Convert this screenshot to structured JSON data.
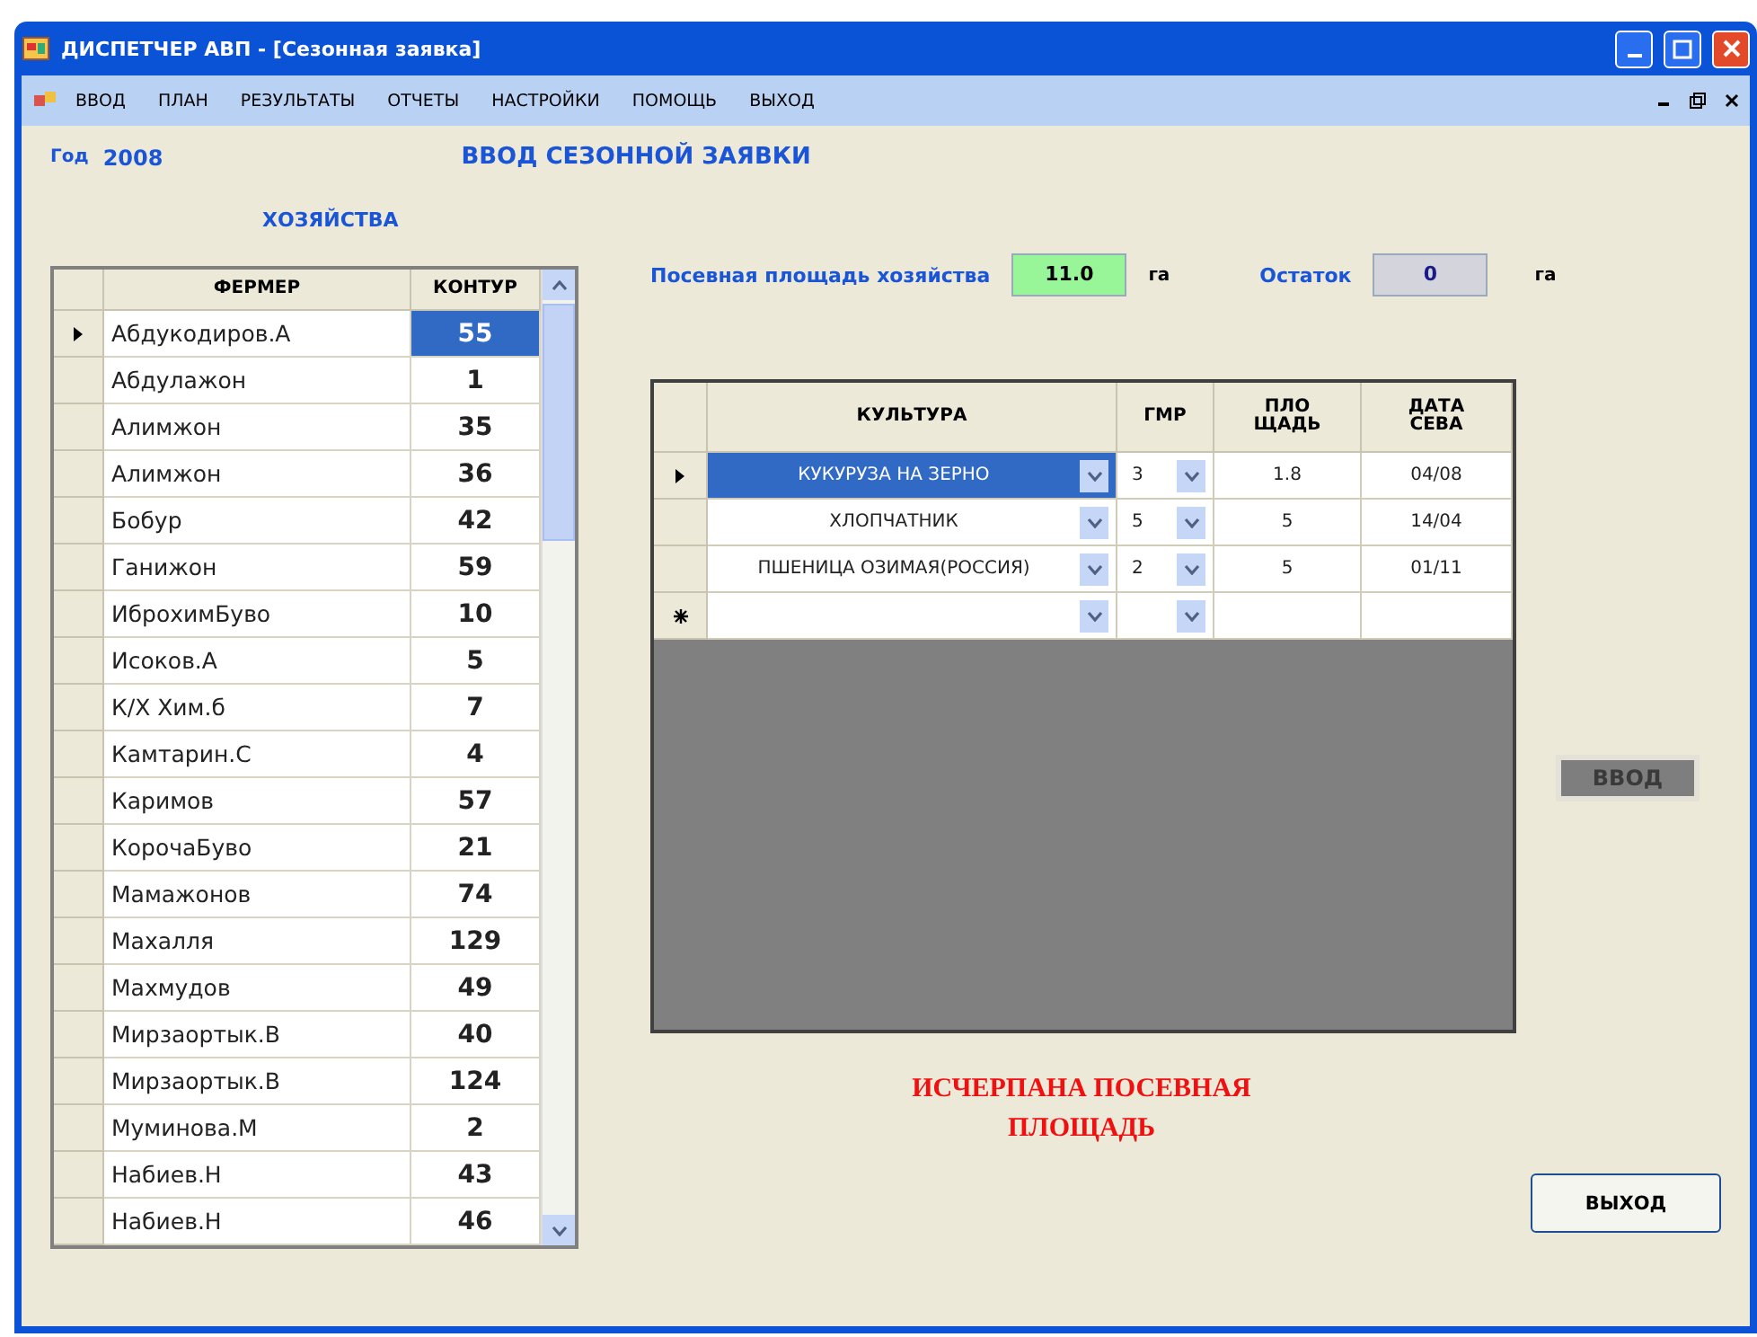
{
  "window": {
    "title": "ДИСПЕТЧЕР АВП - [Сезонная заявка]"
  },
  "menu": [
    {
      "label": "ВВОД"
    },
    {
      "label": "ПЛАН"
    },
    {
      "label": "РЕЗУЛЬТАТЫ"
    },
    {
      "label": "ОТЧЕТЫ"
    },
    {
      "label": "НАСТРОЙКИ"
    },
    {
      "label": "ПОМОЩЬ"
    },
    {
      "label": "ВЫХОД"
    }
  ],
  "year": {
    "label": "Год",
    "value": "2008"
  },
  "heading": "ВВОД СЕЗОННОЙ ЗАЯВКИ",
  "farms_label": "ХОЗЯЙСТВА",
  "farmers": {
    "columns": [
      "ФЕРМЕР",
      "КОНТУР"
    ],
    "rows": [
      {
        "name": "Абдукодиров.А",
        "contour": "55",
        "selected": true
      },
      {
        "name": "Абдулажон",
        "contour": "1",
        "selected": false
      },
      {
        "name": "Алимжон",
        "contour": "35",
        "selected": false
      },
      {
        "name": "Алимжон",
        "contour": "36",
        "selected": false
      },
      {
        "name": "Бобур",
        "contour": "42",
        "selected": false
      },
      {
        "name": "Ганижон",
        "contour": "59",
        "selected": false
      },
      {
        "name": "ИброхимБуво",
        "contour": "10",
        "selected": false
      },
      {
        "name": "Исоков.А",
        "contour": "5",
        "selected": false
      },
      {
        "name": "К/Х Хим.б",
        "contour": "7",
        "selected": false
      },
      {
        "name": "Камтарин.С",
        "contour": "4",
        "selected": false
      },
      {
        "name": "Каримов",
        "contour": "57",
        "selected": false
      },
      {
        "name": "КорочаБуво",
        "contour": "21",
        "selected": false
      },
      {
        "name": "Мамажонов",
        "contour": "74",
        "selected": false
      },
      {
        "name": "Махалля",
        "contour": "129",
        "selected": false
      },
      {
        "name": "Махмудов",
        "contour": "49",
        "selected": false
      },
      {
        "name": "Мирзаортык.В",
        "contour": "40",
        "selected": false
      },
      {
        "name": "Мирзаортык.В",
        "contour": "124",
        "selected": false
      },
      {
        "name": "Муминова.М",
        "contour": "2",
        "selected": false
      },
      {
        "name": "Набиев.Н",
        "contour": "43",
        "selected": false
      },
      {
        "name": "Набиев.Н",
        "contour": "46",
        "selected": false
      }
    ]
  },
  "area": {
    "label": "Посевная площадь хозяйства",
    "value": "11.0",
    "unit": "га"
  },
  "remainder": {
    "label": "Остаток",
    "value": "0",
    "unit": "га"
  },
  "crops": {
    "columns": [
      "КУЛЬТУРА",
      "ГМР",
      "ПЛО ЩАДЬ",
      "ДАТА СЕВА"
    ],
    "rows": [
      {
        "kind": "data",
        "crop": "КУКУРУЗА НА ЗЕРНО",
        "gmr": "3",
        "area": "1.8",
        "date": "04/08",
        "selected": true
      },
      {
        "kind": "data",
        "crop": "ХЛОПЧАТНИК",
        "gmr": "5",
        "area": "5",
        "date": "14/04",
        "selected": false
      },
      {
        "kind": "data",
        "crop": "ПШЕНИЦА ОЗИМАЯ(РОССИЯ)",
        "gmr": "2",
        "area": "5",
        "date": "01/11",
        "selected": false
      },
      {
        "kind": "new",
        "selected": false
      }
    ]
  },
  "enter_button": {
    "label": "ВВОД",
    "disabled": true
  },
  "warning": "ИСЧЕРПАНА ПОСЕВНАЯ ПЛОЩАДЬ",
  "exit_button": {
    "label": "ВЫХОД"
  }
}
